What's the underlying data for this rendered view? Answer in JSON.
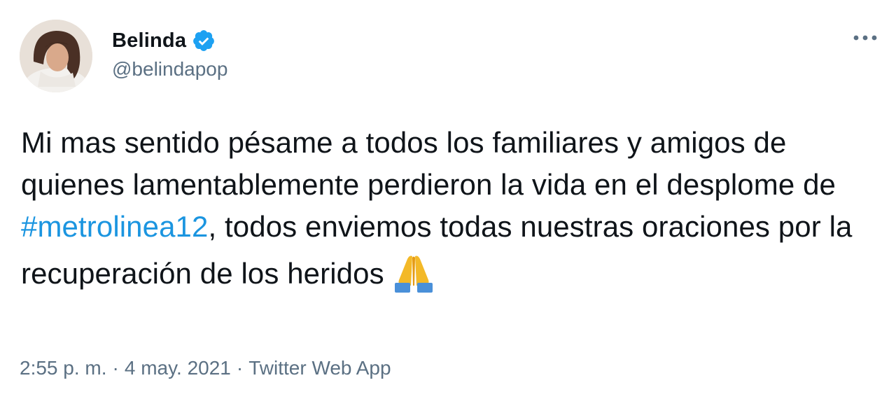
{
  "user": {
    "display_name": "Belinda",
    "handle": "@belindapop",
    "verified": true
  },
  "tweet": {
    "text_before": "Mi mas sentido pésame a todos los familiares y amigos de quienes lamentablemente perdieron la vida en el desplome de ",
    "hashtag": "#metrolinea12",
    "text_after": ", todos enviemos todas nuestras oraciones por la recuperación de los heridos ",
    "emoji": "folded-hands-emoji"
  },
  "meta": {
    "time": "2:55 p. m.",
    "separator": "·",
    "date": "4 may. 2021",
    "source": "Twitter Web App"
  },
  "colors": {
    "text": "#0f1419",
    "secondary": "#5b7083",
    "link": "#1b95e0",
    "verified": "#1da1f2"
  },
  "icons": {
    "more": "more-icon",
    "verified": "verified-badge-icon"
  }
}
